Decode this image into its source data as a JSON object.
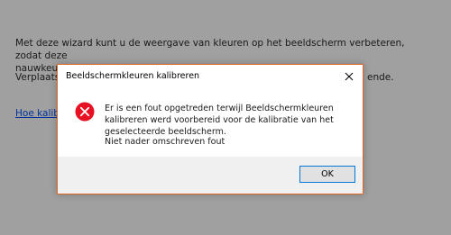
{
  "wizard": {
    "intro_line1": "Met deze wizard kunt u de weergave van kleuren op het beeldscherm verbeteren, zodat deze",
    "intro_line2": "nauwkeuriger worden weergegeven.",
    "move_prefix": "Verplaats d",
    "move_suffix": "ende.",
    "help_link": "Hoe kalibrer"
  },
  "dialog": {
    "title": "Beeldschermkleuren kalibreren",
    "close_icon": "close-icon",
    "message": "Er is een fout opgetreden terwijl Beeldschermkleuren kalibreren werd voorbereid voor de kalibratie van het geselecteerde beeldscherm.",
    "detail": "Niet nader omschreven fout",
    "ok_label": "OK",
    "icon": "error-icon",
    "error_color": "#e81123",
    "border_color": "#e06a2c",
    "button_border_color": "#0078d7"
  }
}
